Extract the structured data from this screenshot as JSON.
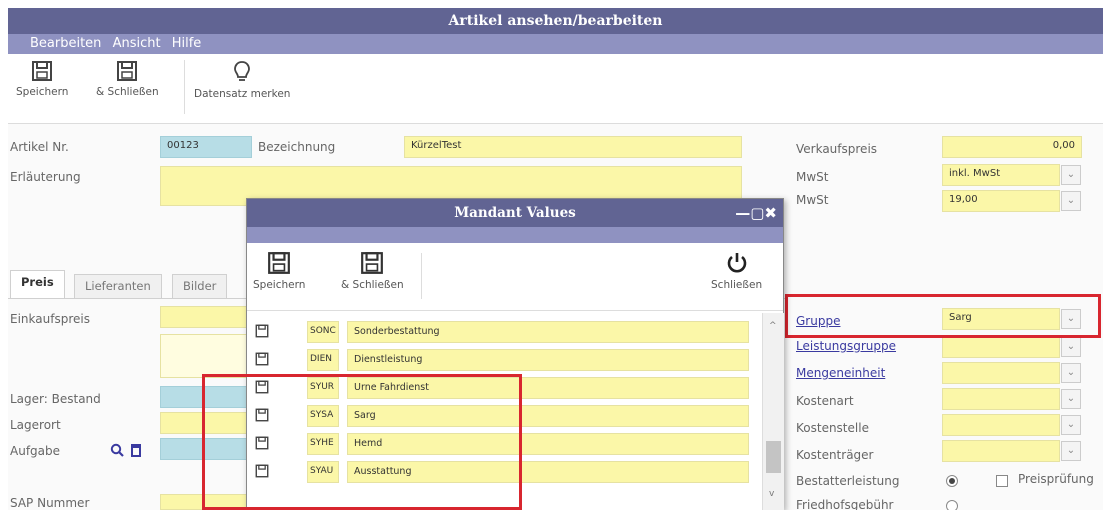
{
  "window": {
    "title": "Artikel ansehen/bearbeiten"
  },
  "menu": [
    "Bearbeiten",
    "Ansicht",
    "Hilfe"
  ],
  "toolbar": {
    "save": "Speichern",
    "save_close": "& Schließen",
    "bookmark": "Datensatz merken"
  },
  "form": {
    "artikel_nr_label": "Artikel Nr.",
    "artikel_nr": "00123",
    "bezeichnung_label": "Bezeichnung",
    "bezeichnung": "KürzelTest",
    "erlaeuterung_label": "Erläuterung",
    "verkaufspreis_label": "Verkaufspreis",
    "verkaufspreis": "0,00",
    "mwst_label1": "MwSt",
    "mwst_value1": "inkl. MwSt",
    "mwst_label2": "MwSt",
    "mwst_value2": "19,00",
    "tabs": [
      "Preis",
      "Lieferanten",
      "Bilder"
    ],
    "einkaufspreis_label": "Einkaufspreis",
    "lager_bestand_label": "Lager: Bestand",
    "lagerort_label": "Lagerort",
    "aufgabe_label": "Aufgabe",
    "sap_label": "SAP Nummer",
    "gruppe_label": "Gruppe",
    "gruppe_value": "Sarg",
    "leistungsgruppe_label": "Leistungsgruppe",
    "mengeneinheit_label": "Mengeneinheit",
    "kostenart_label": "Kostenart",
    "kostenstelle_label": "Kostenstelle",
    "kostentraeger_label": "Kostenträger",
    "bestatterleistung_label": "Bestatterleistung",
    "preispruefung_label": "Preisprüfung",
    "friedhof_label": "Friedhofsgebühr"
  },
  "dialog": {
    "title": "Mandant Values",
    "controls": "—▢✖",
    "save": "Speichern",
    "save_close": "& Schließen",
    "close": "Schließen",
    "rows": [
      {
        "code": "SONC",
        "desc": "Sonderbestattung"
      },
      {
        "code": "DIEN",
        "desc": "Dienstleistung"
      },
      {
        "code": "SYUR",
        "desc": "Urne Fahrdienst"
      },
      {
        "code": "SYSA",
        "desc": "Sarg"
      },
      {
        "code": "SYHE",
        "desc": "Hemd"
      },
      {
        "code": "SYAU",
        "desc": "Ausstattung"
      }
    ]
  },
  "colors": {
    "title": "#616493",
    "menu": "#8f92c1",
    "field": "#fbf7a8",
    "highlight": "#d8262f"
  }
}
